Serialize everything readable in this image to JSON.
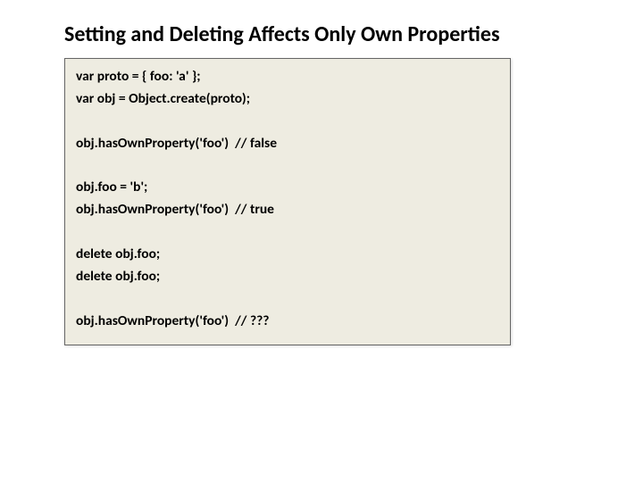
{
  "title": "Setting and Deleting Affects Only Own Properties",
  "code": {
    "lines": [
      "var proto = { foo: 'a' };",
      "var obj = Object.create(proto);",
      "",
      "obj.hasOwnProperty('foo')  // false",
      "",
      "obj.foo = 'b';",
      "obj.hasOwnProperty('foo')  // true",
      "",
      "delete obj.foo;",
      "delete obj.foo;",
      "",
      "obj.hasOwnProperty('foo')  // ???"
    ]
  }
}
